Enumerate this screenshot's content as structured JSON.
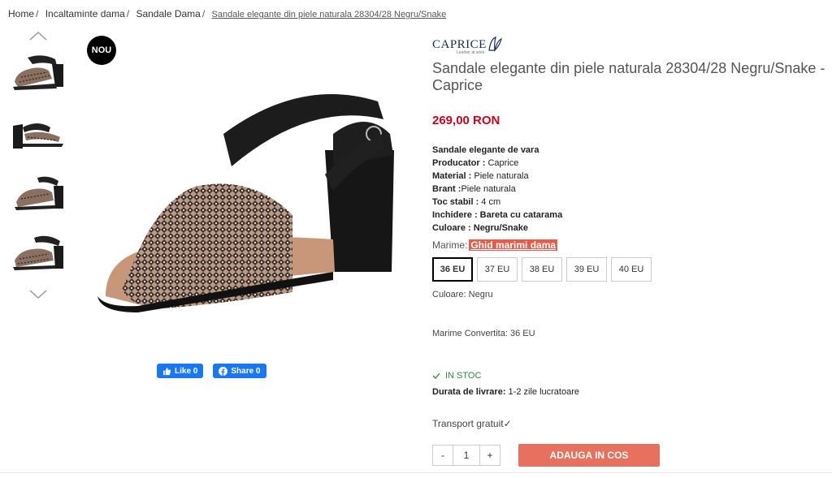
{
  "breadcrumb": {
    "items": [
      "Home",
      "Incaltaminte dama",
      "Sandale Dama"
    ],
    "separator": "/",
    "current": "Sandale elegante din piele naturala 28304/28 Negru/Snake"
  },
  "badge": "NOU",
  "thumbnails": {
    "up_icon": "chevron-up-icon",
    "down_icon": "chevron-down-icon",
    "count": 4
  },
  "social": {
    "like_label": "Like 0",
    "share_label": "Share 0"
  },
  "product": {
    "brand": "CAPRICE",
    "brand_tagline": "Leather at work",
    "title": "Sandale elegante din piele naturala 28304/28 Negru/Snake - Caprice",
    "price": "269,00 RON",
    "specs_heading": "Sandale elegante de vara",
    "specs": [
      {
        "label": "Producator :",
        "value": " Caprice",
        "bold_value": false
      },
      {
        "label": "Material :",
        "value": " Piele naturala",
        "bold_value": false
      },
      {
        "label": "Brant :",
        "value": "Piele naturala",
        "bold_value": false
      },
      {
        "label": "Toc stabil :",
        "value": " 4 cm",
        "bold_value": false
      },
      {
        "label": "Inchidere :",
        "value": " Bareta cu catarama",
        "bold_value": true
      },
      {
        "label": "Culoare :",
        "value": " Negru/Snake",
        "bold_value": true
      }
    ],
    "size_label": "Marime:",
    "size_guide": "Ghid marimi dama",
    "sizes": [
      "36 EU",
      "37 EU",
      "38 EU",
      "39 EU",
      "40 EU"
    ],
    "selected_size": "36 EU",
    "color_line": "Culoare: Negru",
    "converted_size": "Marime Convertita: 36 EU",
    "stock": "IN STOC",
    "delivery_label": "Durata de livrare:",
    "delivery_value": "1-2 zile lucratoare",
    "transport": "Transport gratuit✓",
    "qty_minus": "-",
    "qty_value": "1",
    "qty_plus": "+",
    "add_to_cart": "ADAUGA IN COS"
  },
  "colors": {
    "price": "#d0021b",
    "size_guide_bg": "#e85c4a",
    "add_button": "#e8705f",
    "stock": "#2a8a3a",
    "facebook": "#1877f2"
  }
}
